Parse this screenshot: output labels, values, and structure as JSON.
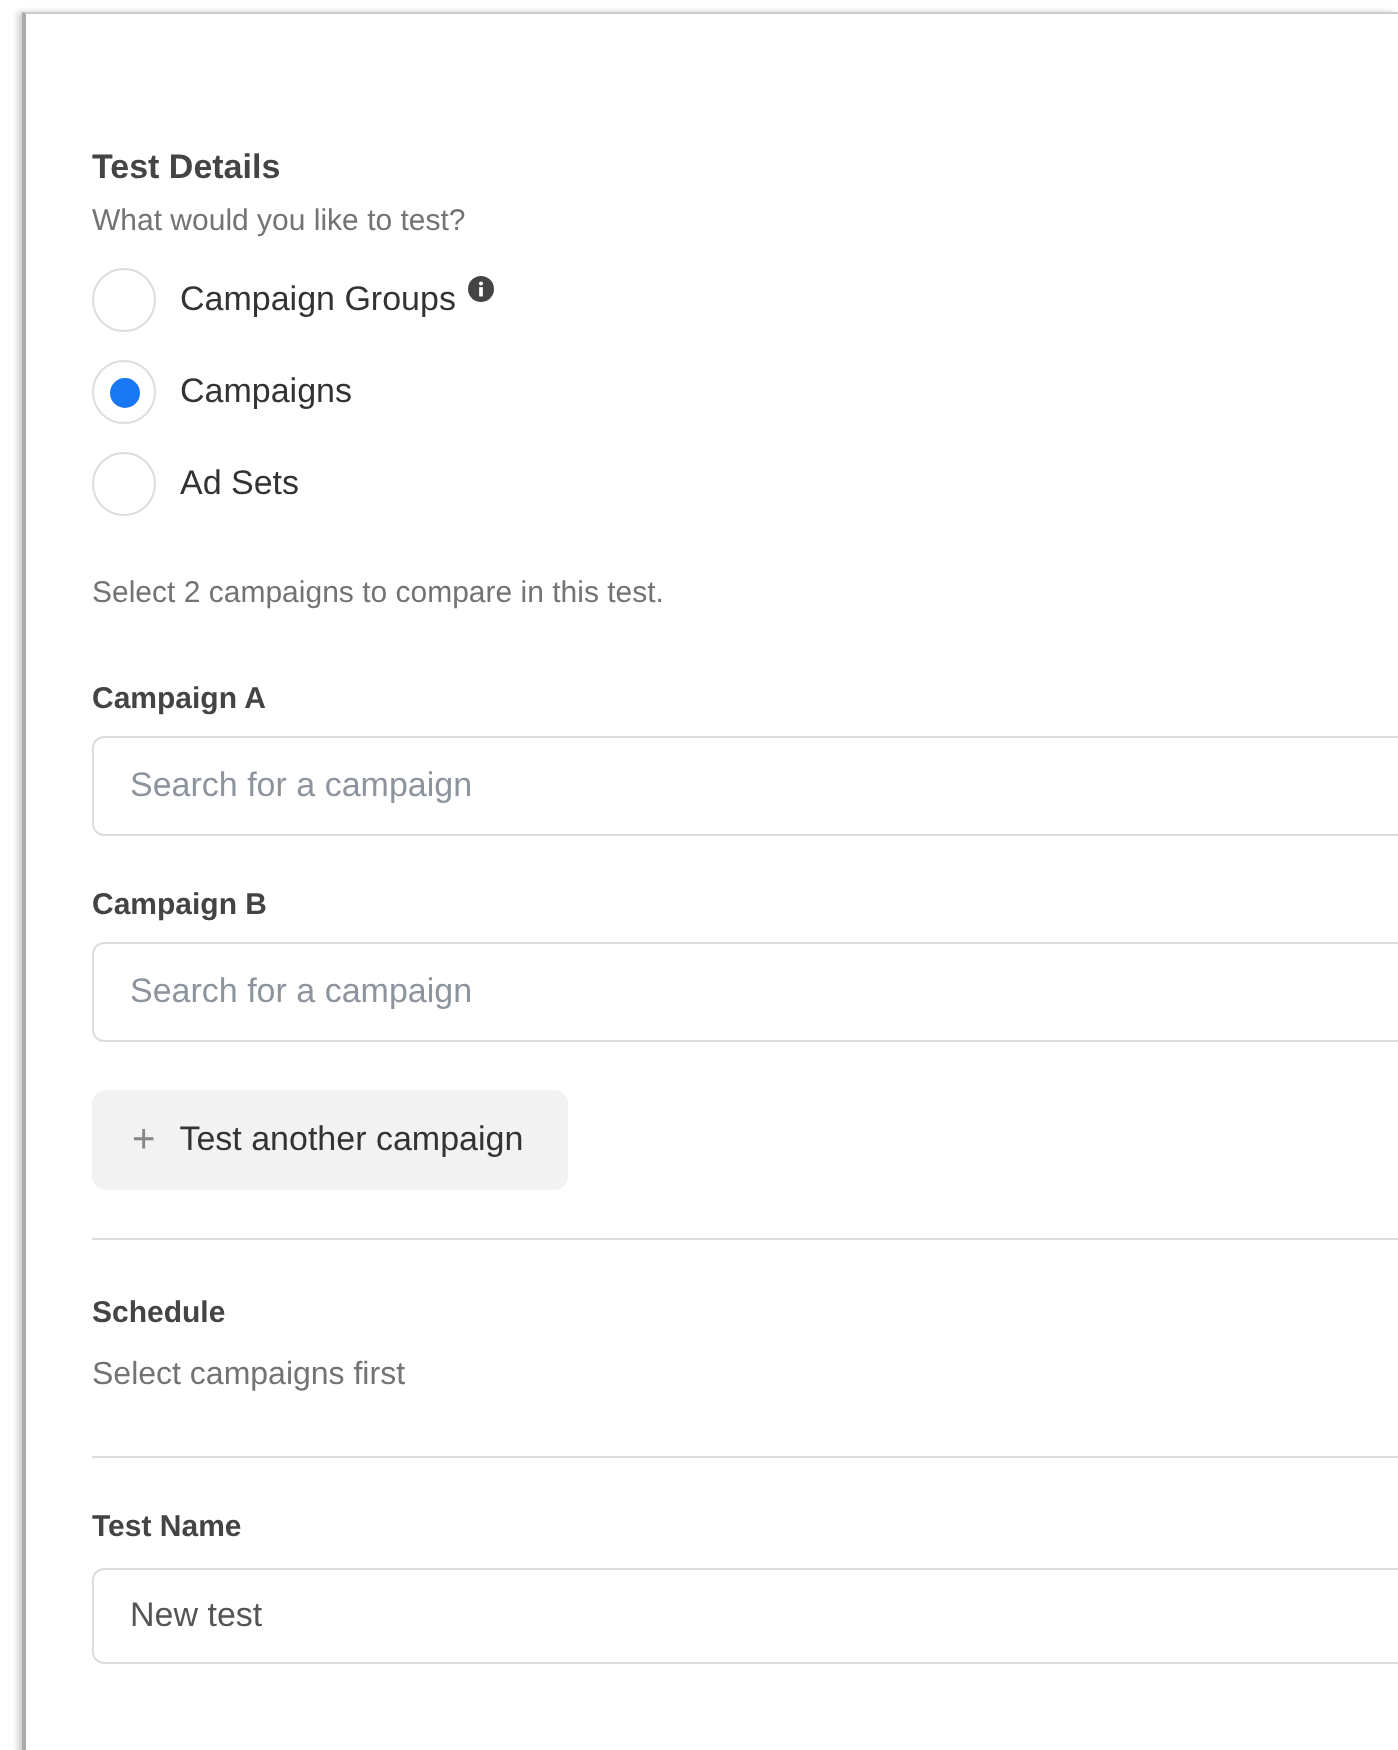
{
  "section_title": "Test Details",
  "question": "What would you like to test?",
  "test_types": [
    {
      "label": "Campaign Groups",
      "selected": false,
      "info": true
    },
    {
      "label": "Campaigns",
      "selected": true,
      "info": false
    },
    {
      "label": "Ad Sets",
      "selected": false,
      "info": false
    }
  ],
  "instruction": "Select 2 campaigns to compare in this test.",
  "campaign_fields": [
    {
      "label": "Campaign A",
      "placeholder": "Search for a campaign"
    },
    {
      "label": "Campaign B",
      "placeholder": "Search for a campaign"
    }
  ],
  "add_button": {
    "icon": "+",
    "label": "Test another campaign"
  },
  "schedule": {
    "title": "Schedule",
    "note": "Select campaigns first"
  },
  "test_name": {
    "label": "Test Name",
    "value": "New test"
  }
}
